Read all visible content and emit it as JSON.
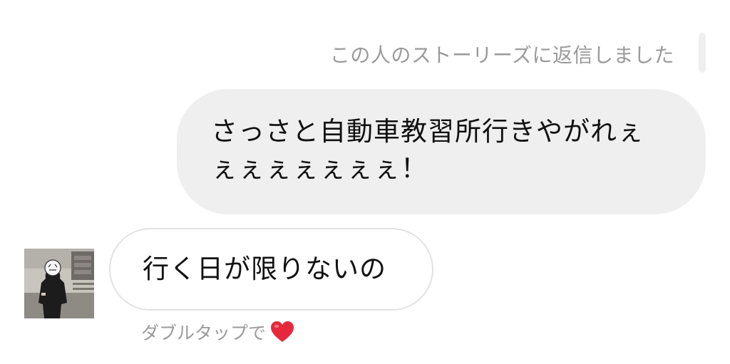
{
  "chat": {
    "story_reply_label": "この人のストーリーズに返信しました",
    "outgoing_message": {
      "line1": "さっさと自動車教習所行きやがれぇ",
      "line2": "ぇぇぇぇぇぇぇ！"
    },
    "incoming_message": "行く日が限りないの",
    "double_tap_hint": "ダブルタップで",
    "heart_icon": "heart-icon",
    "colors": {
      "outgoing_bubble": "#efefef",
      "incoming_border": "#e2e2e2",
      "meta_text": "#9a9a9a",
      "heart": "#e6283c"
    }
  }
}
